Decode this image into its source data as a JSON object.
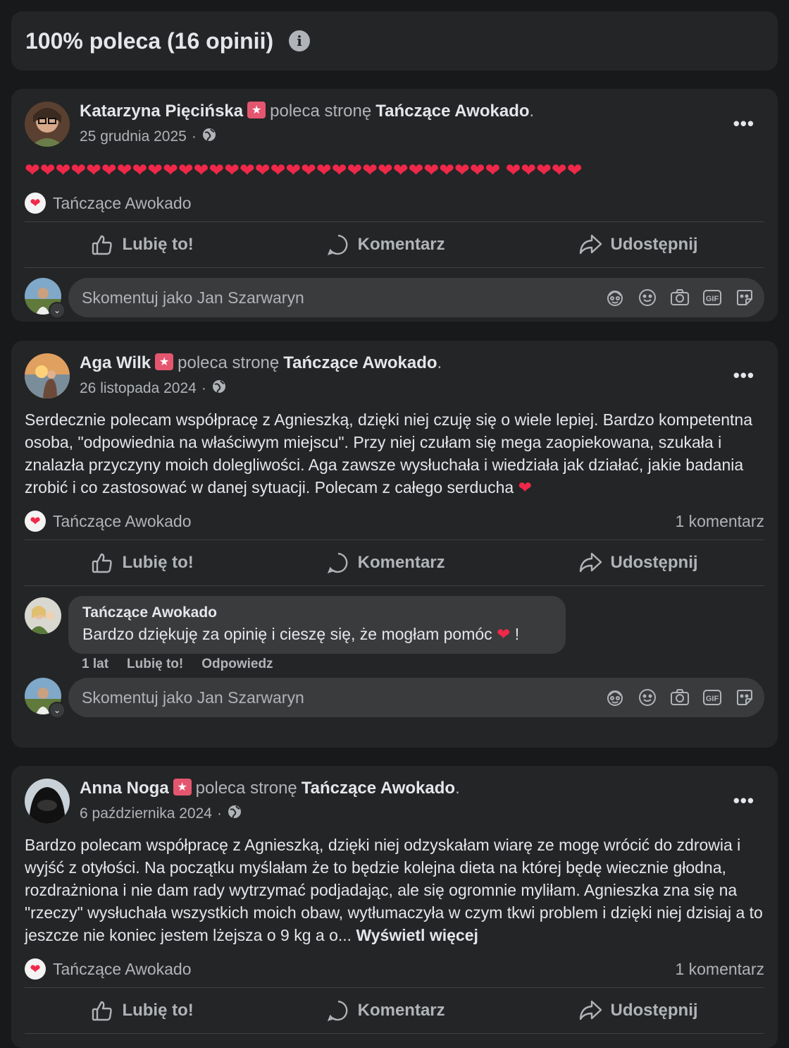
{
  "header": {
    "title": "100% poleca (16 opinii)",
    "info_icon": "info-icon"
  },
  "comment_input": {
    "placeholder": "Skomentuj jako Jan Szarwaryn"
  },
  "actions": {
    "like": "Lubię to!",
    "comment": "Komentarz",
    "share": "Udostępnij"
  },
  "reviews": [
    {
      "author": "Katarzyna Pięcińska",
      "verb": "poleca stronę",
      "page": "Tańczące Awokado",
      "period": ".",
      "date": "25 grudnia 2025",
      "separator": "·",
      "body_hearts": 36,
      "tag": "Tańczące Awokado"
    },
    {
      "author": "Aga Wilk",
      "verb": "poleca stronę",
      "page": "Tańczące Awokado",
      "period": ".",
      "date": "26 listopada 2024",
      "separator": "·",
      "body": "Serdecznie polecam współpracę z Agnieszką, dzięki niej czuję się o wiele lepiej. Bardzo kompetentna osoba,  \"odpowiednia na właściwym miejscu\". Przy niej czułam się mega zaopiekowana, szukała i znalazła przyczyny moich dolegliwości. Aga zawsze wysłuchała i wiedziała jak działać, jakie badania zrobić i co zastosować w danej sytuacji. Polecam z całego serducha",
      "tag": "Tańczące Awokado",
      "comment_count": "1 komentarz",
      "reply": {
        "author": "Tańczące Awokado",
        "text": "Bardzo dziękuję za opinię i cieszę się, że mogłam pomóc",
        "text_end": "!",
        "age": "1 lat",
        "like": "Lubię to!",
        "reply": "Odpowiedz"
      }
    },
    {
      "author": "Anna Noga",
      "verb": "poleca stronę",
      "page": "Tańczące Awokado",
      "period": ".",
      "date": "6 października 2024",
      "separator": "·",
      "body": "Bardzo polecam współpracę z Agnieszką, dzięki niej odzyskałam wiarę ze mogę wrócić do zdrowia i wyjść z otyłości. Na początku myślałam że to będzie kolejna dieta na której będę wiecznie głodna, rozdrażniona i nie dam rady wytrzymać podjadając, ale się ogromnie myliłam. Agnieszka zna się na \"rzeczy\" wysłuchała wszystkich moich obaw, wytłumaczyła w czym tkwi problem i dzięki niej dzisiaj a to jeszcze nie koniec jestem lżejsza o 9 kg a o...",
      "see_more": "Wyświetl więcej",
      "tag": "Tańczące Awokado",
      "comment_count": "1 komentarz"
    }
  ],
  "colors": {
    "background": "#18191a",
    "card": "#242526",
    "heart": "#f02849",
    "badge": "#e4566f"
  }
}
